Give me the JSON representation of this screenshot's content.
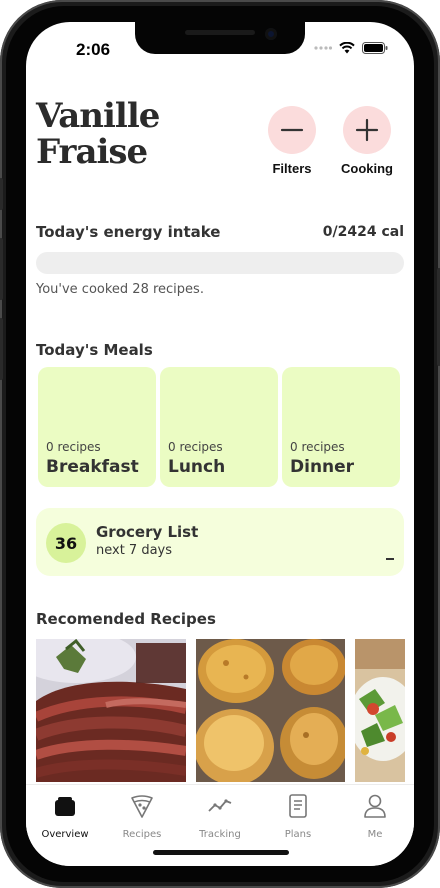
{
  "status_bar": {
    "time": "2:06"
  },
  "header": {
    "brand_line1": "Vanille",
    "brand_line2": "Fraise",
    "filters_label": "Filters",
    "cooking_label": "Cooking"
  },
  "energy": {
    "title": "Today's energy intake",
    "value": "0/2424 cal",
    "progress_fraction": 0,
    "cooked_text": "You've cooked 28 recipes."
  },
  "meals": {
    "title": "Today's Meals",
    "items": [
      {
        "count": "0 recipes",
        "name": "Breakfast"
      },
      {
        "count": "0 recipes",
        "name": "Lunch"
      },
      {
        "count": "0 recipes",
        "name": "Dinner"
      }
    ]
  },
  "grocery": {
    "count": "36",
    "title": "Grocery List",
    "subtitle": "next 7 days"
  },
  "recommended": {
    "title": "Recomended Recipes"
  },
  "tabs": [
    {
      "label": "Overview",
      "icon": "pot-icon",
      "active": true
    },
    {
      "label": "Recipes",
      "icon": "pizza-slice-icon",
      "active": false
    },
    {
      "label": "Tracking",
      "icon": "trend-line-icon",
      "active": false
    },
    {
      "label": "Plans",
      "icon": "document-icon",
      "active": false
    },
    {
      "label": "Me",
      "icon": "person-icon",
      "active": false
    }
  ],
  "colors": {
    "accent_pink": "#fbdcdc",
    "meal_card_green": "#ebfcc3",
    "grocery_bg": "#f5fedc",
    "badge_green": "#d8f29a"
  }
}
